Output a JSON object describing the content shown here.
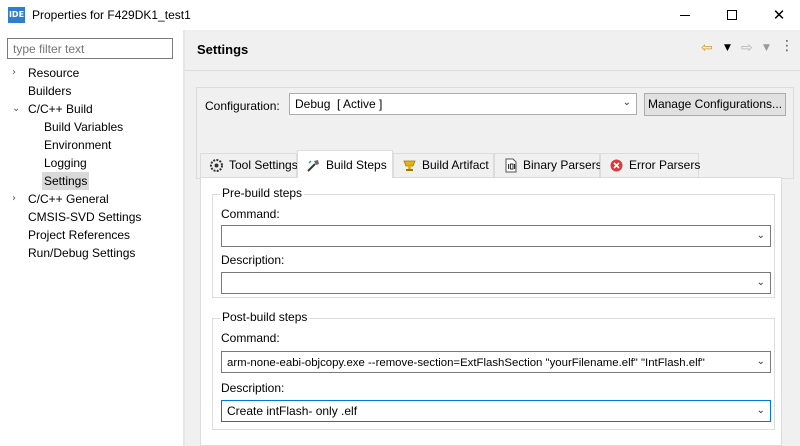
{
  "window": {
    "app_icon_text": "IDE",
    "title": "Properties for F429DK1_test1"
  },
  "filter": {
    "placeholder": "type filter text"
  },
  "tree": [
    {
      "label": "Resource",
      "level": 0,
      "expander": "collapsed"
    },
    {
      "label": "Builders",
      "level": 0,
      "expander": "none"
    },
    {
      "label": "C/C++ Build",
      "level": 0,
      "expander": "expanded"
    },
    {
      "label": "Build Variables",
      "level": 1,
      "expander": "none"
    },
    {
      "label": "Environment",
      "level": 1,
      "expander": "none"
    },
    {
      "label": "Logging",
      "level": 1,
      "expander": "none"
    },
    {
      "label": "Settings",
      "level": 1,
      "expander": "none",
      "selected": true
    },
    {
      "label": "C/C++ General",
      "level": 0,
      "expander": "collapsed"
    },
    {
      "label": "CMSIS-SVD Settings",
      "level": 0,
      "expander": "none"
    },
    {
      "label": "Project References",
      "level": 0,
      "expander": "none"
    },
    {
      "label": "Run/Debug Settings",
      "level": 0,
      "expander": "none"
    }
  ],
  "page": {
    "title": "Settings",
    "icons": [
      "back-arrow-icon",
      "back-menu-icon",
      "forward-arrow-icon",
      "forward-menu-icon",
      "more-options-icon"
    ]
  },
  "configuration": {
    "label": "Configuration:",
    "value": "Debug  [ Active ]",
    "manage_button": "Manage Configurations..."
  },
  "tabs": [
    {
      "label": "Tool Settings",
      "icon": "tool-settings-icon"
    },
    {
      "label": "Build Steps",
      "icon": "build-steps-icon",
      "active": true
    },
    {
      "label": "Build Artifact",
      "icon": "build-artifact-icon"
    },
    {
      "label": "Binary Parsers",
      "icon": "binary-parsers-icon"
    },
    {
      "label": "Error Parsers",
      "icon": "error-parsers-icon"
    }
  ],
  "pre_build": {
    "title": "Pre-build steps",
    "command_label": "Command:",
    "command_value": "",
    "description_label": "Description:",
    "description_value": ""
  },
  "post_build": {
    "title": "Post-build steps",
    "command_label": "Command:",
    "command_value": "arm-none-eabi-objcopy.exe --remove-section=ExtFlashSection \"yourFilename.elf\" \"IntFlash.elf\"",
    "description_label": "Description:",
    "description_value": "Create intFlash- only .elf"
  },
  "colors": {
    "accent": "#0078d7",
    "selection": "#d9d9d9",
    "panel_bg": "#f0f0f0"
  }
}
